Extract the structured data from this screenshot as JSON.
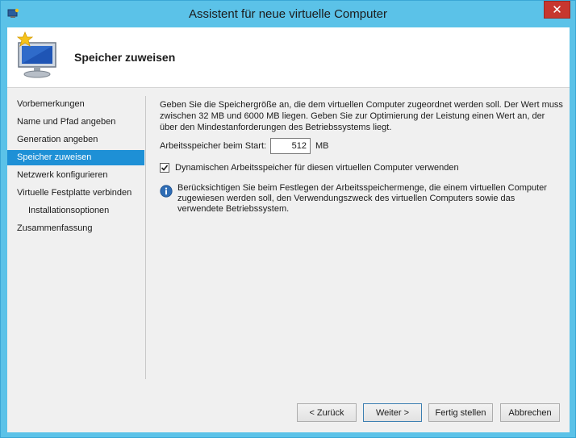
{
  "window": {
    "title": "Assistent für neue virtuelle Computer",
    "close_glyph": "✕"
  },
  "header": {
    "page_title": "Speicher zuweisen"
  },
  "nav": {
    "items": [
      {
        "label": "Vorbemerkungen"
      },
      {
        "label": "Name und Pfad angeben"
      },
      {
        "label": "Generation angeben"
      },
      {
        "label": "Speicher zuweisen"
      },
      {
        "label": "Netzwerk konfigurieren"
      },
      {
        "label": "Virtuelle Festplatte verbinden"
      },
      {
        "label": "Installationsoptionen"
      },
      {
        "label": "Zusammenfassung"
      }
    ],
    "active_index": 3
  },
  "content": {
    "description": "Geben Sie die Speichergröße an, die dem virtuellen Computer zugeordnet werden soll. Der Wert muss zwischen 32 MB und 6000 MB liegen. Geben Sie zur Optimierung der Leistung einen Wert an, der über den Mindestanforderungen des Betriebssystems liegt.",
    "memory_label": "Arbeitsspeicher beim Start:",
    "memory_value": "512",
    "memory_unit": "MB",
    "dynamic_memory_label": "Dynamischen Arbeitsspeicher für diesen virtuellen Computer verwenden",
    "dynamic_memory_checked": true,
    "info_text": "Berücksichtigen Sie beim Festlegen der Arbeitsspeichermenge, die einem virtuellen Computer zugewiesen werden soll, den Verwendungszweck des virtuellen Computers sowie das verwendete Betriebssystem."
  },
  "buttons": {
    "back": "< Zurück",
    "next": "Weiter >",
    "finish": "Fertig stellen",
    "cancel": "Abbrechen"
  },
  "colors": {
    "frame": "#5bc2e8",
    "close": "#c7372f",
    "nav_active": "#1e90d6",
    "info_icon": "#2f6db5"
  }
}
